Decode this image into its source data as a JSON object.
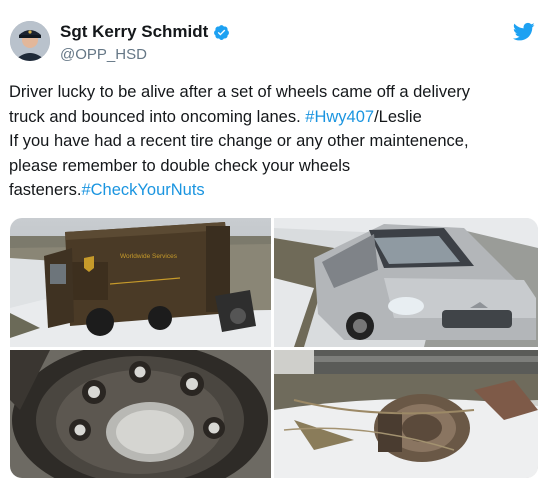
{
  "author": {
    "name": "Sgt Kerry Schmidt",
    "handle": "@OPP_HSD",
    "verified_icon": "verified-badge-icon",
    "avatar": "avatar"
  },
  "platform_icon": "twitter-bird-icon",
  "tweet": {
    "line1": "Driver lucky to be alive after a set of wheels came off a delivery",
    "line2_pre": "truck and bounced into oncoming lanes.  ",
    "hashtag_hwy": "#Hwy407",
    "line2_post": "/Leslie",
    "line3": "If you have had a recent tire change or any other maintenence,",
    "line4": "please remember to double check your wheels",
    "line5_pre": "fasteners.",
    "hashtag_nuts": "#CheckYourNuts"
  },
  "media": {
    "photo1_truck_text": "Worldwide Services",
    "photos": [
      "delivery-truck-in-ditch",
      "damaged-silver-car",
      "wheel-hub-closeup",
      "detached-wheel-assembly"
    ]
  },
  "colors": {
    "link": "#1b95e0",
    "text": "#14171a",
    "handle": "#657786",
    "verified": "#1da1f2"
  }
}
